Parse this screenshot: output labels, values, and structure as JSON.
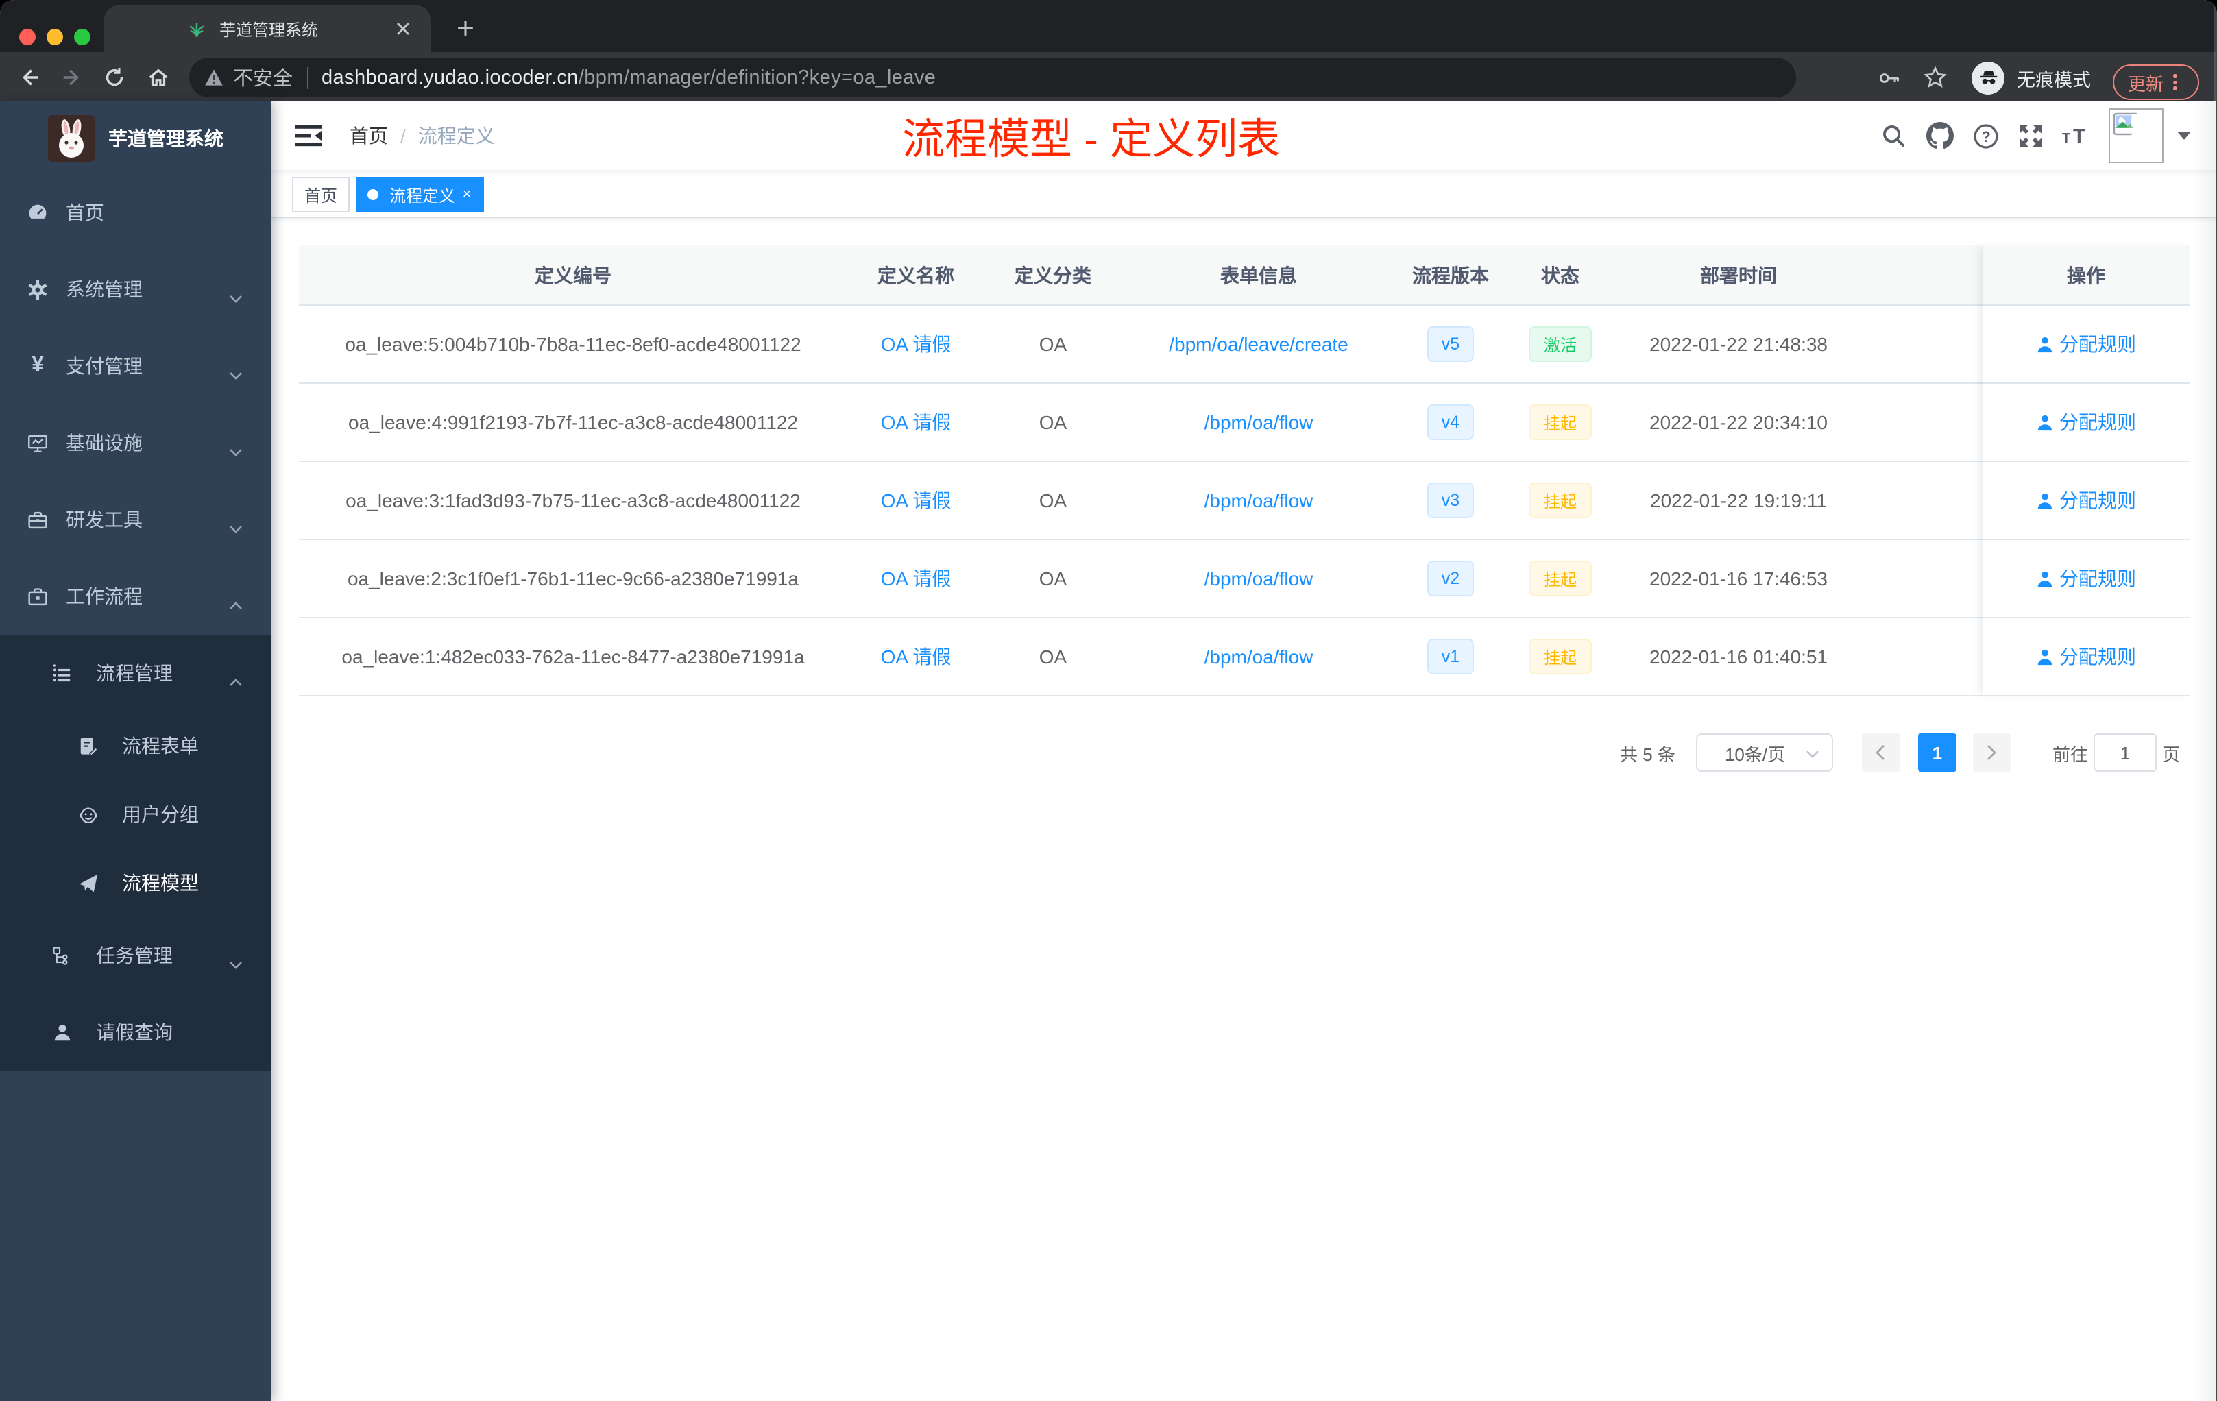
{
  "browser": {
    "tab_title": "芋道管理系统",
    "security": "不安全",
    "url_domain": "dashboard.yudao.iocoder.cn",
    "url_path": "/bpm/manager/definition?key=oa_leave",
    "incognito": "无痕模式",
    "update": "更新"
  },
  "sidebar": {
    "title": "芋道管理系统",
    "items": [
      {
        "label": "首页"
      },
      {
        "label": "系统管理"
      },
      {
        "label": "支付管理"
      },
      {
        "label": "基础设施"
      },
      {
        "label": "研发工具"
      },
      {
        "label": "工作流程"
      },
      {
        "label": "流程管理"
      },
      {
        "label": "流程表单"
      },
      {
        "label": "用户分组"
      },
      {
        "label": "流程模型"
      },
      {
        "label": "任务管理"
      },
      {
        "label": "请假查询"
      }
    ]
  },
  "nav": {
    "breadcrumb_home": "首页",
    "breadcrumb_current": "流程定义",
    "annotation": "流程模型 - 定义列表"
  },
  "tags": {
    "home": "首页",
    "active": "流程定义"
  },
  "table": {
    "columns": [
      "定义编号",
      "定义名称",
      "定义分类",
      "表单信息",
      "流程版本",
      "状态",
      "部署时间",
      "操作"
    ],
    "action": "分配规则",
    "rows": [
      {
        "id": "oa_leave:5:004b710b-7b8a-11ec-8ef0-acde48001122",
        "name": "OA 请假",
        "category": "OA",
        "form": "/bpm/oa/leave/create",
        "version": "v5",
        "status": "激活",
        "time": "2022-01-22 21:48:38"
      },
      {
        "id": "oa_leave:4:991f2193-7b7f-11ec-a3c8-acde48001122",
        "name": "OA 请假",
        "category": "OA",
        "form": "/bpm/oa/flow",
        "version": "v4",
        "status": "挂起",
        "time": "2022-01-22 20:34:10"
      },
      {
        "id": "oa_leave:3:1fad3d93-7b75-11ec-a3c8-acde48001122",
        "name": "OA 请假",
        "category": "OA",
        "form": "/bpm/oa/flow",
        "version": "v3",
        "status": "挂起",
        "time": "2022-01-22 19:19:11"
      },
      {
        "id": "oa_leave:2:3c1f0ef1-76b1-11ec-9c66-a2380e71991a",
        "name": "OA 请假",
        "category": "OA",
        "form": "/bpm/oa/flow",
        "version": "v2",
        "status": "挂起",
        "time": "2022-01-16 17:46:53"
      },
      {
        "id": "oa_leave:1:482ec033-762a-11ec-8477-a2380e71991a",
        "name": "OA 请假",
        "category": "OA",
        "form": "/bpm/oa/flow",
        "version": "v1",
        "status": "挂起",
        "time": "2022-01-16 01:40:51"
      }
    ]
  },
  "pager": {
    "total": "共 5 条",
    "size": "10条/页",
    "page": "1",
    "goto": "前往",
    "goto_value": "1",
    "unit": "页"
  },
  "colors": {
    "primary": "#1890ff",
    "success": "#13ce66",
    "warning": "#ffba00",
    "annotation_red": "#ff2700",
    "sidebar_bg": "#304156",
    "sidebar_submenu_bg": "#1f2d3d"
  }
}
